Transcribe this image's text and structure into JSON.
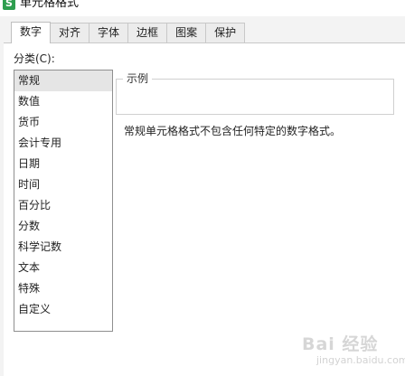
{
  "window": {
    "title": "单元格格式",
    "app_icon": "spreadsheet-app-icon"
  },
  "tabs": [
    {
      "label": "数字",
      "active": true
    },
    {
      "label": "对齐",
      "active": false
    },
    {
      "label": "字体",
      "active": false
    },
    {
      "label": "边框",
      "active": false
    },
    {
      "label": "图案",
      "active": false
    },
    {
      "label": "保护",
      "active": false
    }
  ],
  "category": {
    "label": "分类(C):",
    "items": [
      "常规",
      "数值",
      "货币",
      "会计专用",
      "日期",
      "时间",
      "百分比",
      "分数",
      "科学记数",
      "文本",
      "特殊",
      "自定义"
    ],
    "selected": "常规"
  },
  "sample": {
    "label": "示例",
    "value": ""
  },
  "description": "常规单元格格式不包含任何特定的数字格式。",
  "watermark": {
    "text": "Bai 经验",
    "sub": "jingyan.baidu.com"
  }
}
